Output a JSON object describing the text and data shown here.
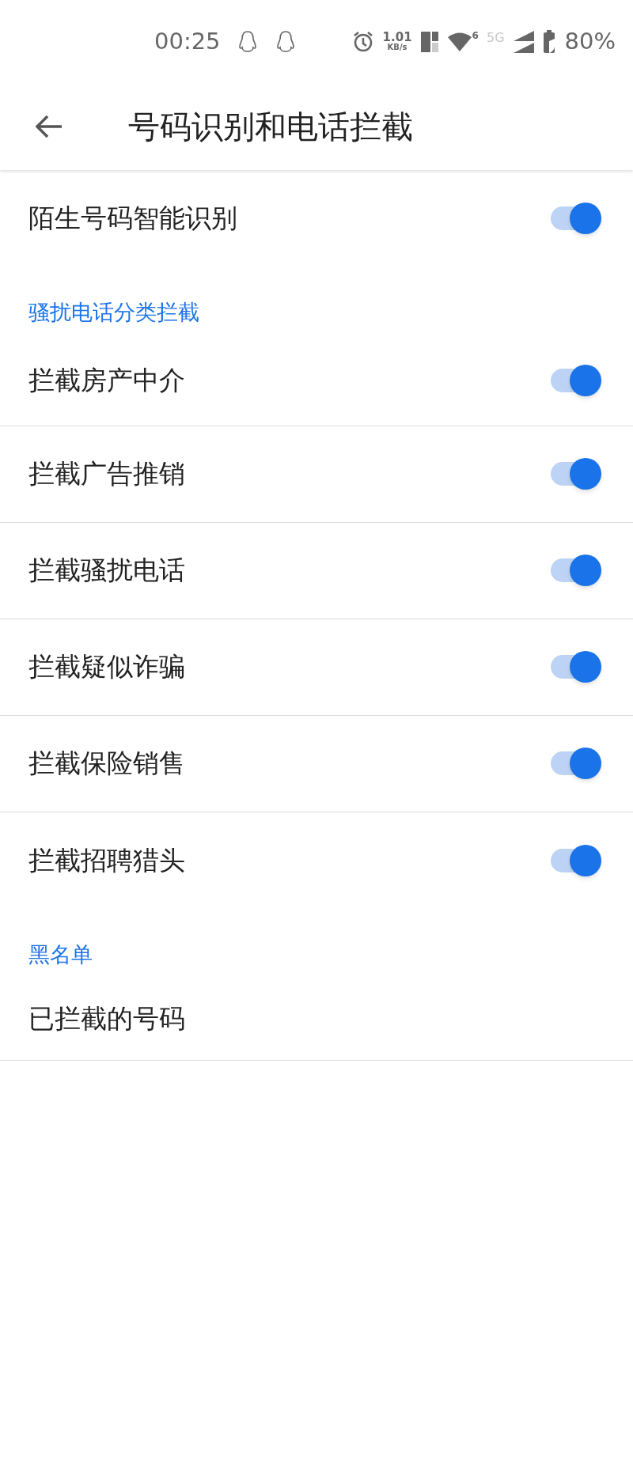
{
  "status_bar": {
    "time": "00:25",
    "speed": "1.01",
    "speed_unit": "KB/s",
    "wifi_badge": "6",
    "network": "5G",
    "battery": "80%"
  },
  "app_bar": {
    "title": "号码识别和电话拦截"
  },
  "sections": [
    {
      "items": [
        {
          "kind": "toggle",
          "label": "陌生号码智能识别",
          "on": true
        }
      ]
    },
    {
      "header": "骚扰电话分类拦截",
      "items": [
        {
          "kind": "toggle",
          "label": "拦截房产中介",
          "on": true
        },
        {
          "kind": "toggle",
          "label": "拦截广告推销",
          "on": true
        },
        {
          "kind": "toggle",
          "label": "拦截骚扰电话",
          "on": true
        },
        {
          "kind": "toggle",
          "label": "拦截疑似诈骗",
          "on": true
        },
        {
          "kind": "toggle",
          "label": "拦截保险销售",
          "on": true
        },
        {
          "kind": "toggle",
          "label": "拦截招聘猎头",
          "on": true
        }
      ]
    },
    {
      "header": "黑名单",
      "items": [
        {
          "kind": "link",
          "label": "已拦截的号码"
        }
      ]
    }
  ]
}
